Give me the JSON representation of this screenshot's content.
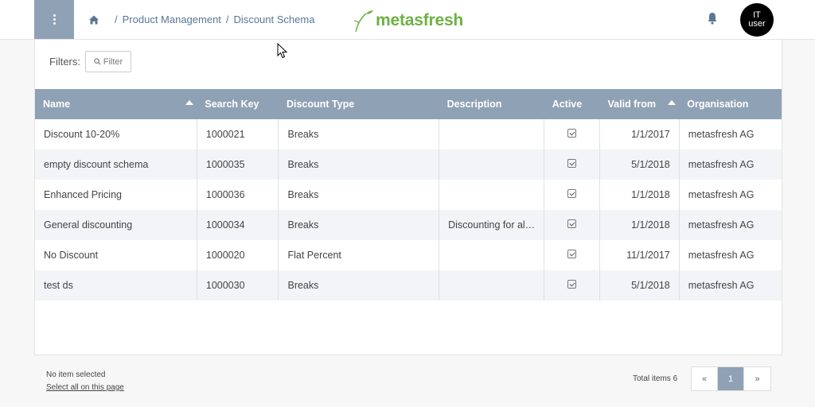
{
  "header": {
    "breadcrumb": [
      "Product Management",
      "Discount Schema"
    ],
    "breadcrumb_sep": "/",
    "logo_text": "metasfresh",
    "avatar_line1": "IT",
    "avatar_line2": "user"
  },
  "filters": {
    "label": "Filters:",
    "button_label": "Filter"
  },
  "table": {
    "columns": [
      "Name",
      "Search Key",
      "Discount Type",
      "Description",
      "Active",
      "Valid from",
      "Organisation"
    ],
    "rows": [
      {
        "name": "Discount 10-20%",
        "search_key": "1000021",
        "type": "Breaks",
        "description": "",
        "active": true,
        "valid_from": "1/1/2017",
        "org": "metasfresh AG"
      },
      {
        "name": "empty discount schema",
        "search_key": "1000035",
        "type": "Breaks",
        "description": "",
        "active": true,
        "valid_from": "5/1/2018",
        "org": "metasfresh AG"
      },
      {
        "name": "Enhanced Pricing",
        "search_key": "1000036",
        "type": "Breaks",
        "description": "",
        "active": true,
        "valid_from": "1/1/2018",
        "org": "metasfresh AG"
      },
      {
        "name": "General discounting",
        "search_key": "1000034",
        "type": "Breaks",
        "description": "Discounting for al…",
        "active": true,
        "valid_from": "1/1/2018",
        "org": "metasfresh AG"
      },
      {
        "name": "No Discount",
        "search_key": "1000020",
        "type": "Flat Percent",
        "description": "",
        "active": true,
        "valid_from": "11/1/2017",
        "org": "metasfresh AG"
      },
      {
        "name": "test ds",
        "search_key": "1000030",
        "type": "Breaks",
        "description": "",
        "active": true,
        "valid_from": "5/1/2018",
        "org": "metasfresh AG"
      }
    ]
  },
  "footer": {
    "selection_status": "No item selected",
    "select_all_link": "Select all on this page",
    "total_label": "Total items 6",
    "pager_prev": "«",
    "pager_current": "1",
    "pager_next": "»"
  },
  "colors": {
    "accent": "#8fa1b5",
    "logo_green": "#6cb142",
    "link_blue": "#5a7894"
  },
  "icons": {
    "menu": "menu-dots-icon",
    "home": "home-icon",
    "bell": "bell-icon",
    "search": "search-icon",
    "checkbox": "checkbox-checked-icon",
    "sort": "sort-asc-icon"
  }
}
